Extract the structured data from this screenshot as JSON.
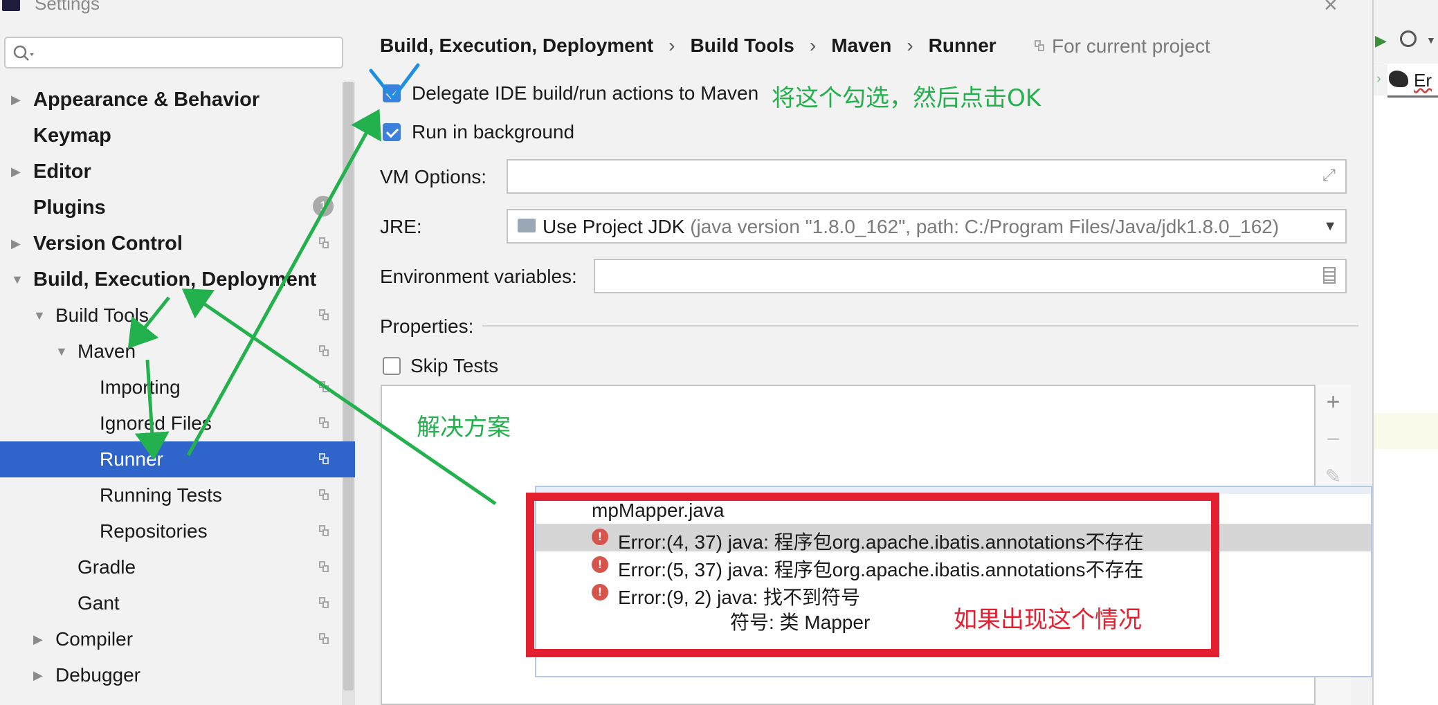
{
  "window": {
    "title": "Settings"
  },
  "sidebar": {
    "search_placeholder": "",
    "plugins_badge": "1",
    "items": [
      {
        "label": "Appearance & Behavior"
      },
      {
        "label": "Keymap"
      },
      {
        "label": "Editor"
      },
      {
        "label": "Plugins"
      },
      {
        "label": "Version Control"
      },
      {
        "label": "Build, Execution, Deployment"
      },
      {
        "label": "Build Tools"
      },
      {
        "label": "Maven"
      },
      {
        "label": "Importing"
      },
      {
        "label": "Ignored Files"
      },
      {
        "label": "Runner"
      },
      {
        "label": "Running Tests"
      },
      {
        "label": "Repositories"
      },
      {
        "label": "Gradle"
      },
      {
        "label": "Gant"
      },
      {
        "label": "Compiler"
      },
      {
        "label": "Debugger"
      }
    ]
  },
  "main": {
    "breadcrumb": [
      "Build, Execution, Deployment",
      "Build Tools",
      "Maven",
      "Runner"
    ],
    "breadcrumb_separator": "›",
    "for_current_project": "For current project",
    "delegate_label": "Delegate IDE build/run actions to Maven",
    "delegate_checked": true,
    "run_bg_label": "Run in background",
    "run_bg_checked": true,
    "vm_options_label": "VM Options:",
    "vm_options_value": "",
    "jre_label": "JRE:",
    "jre_value": "Use Project JDK",
    "jre_detail": "(java version \"1.8.0_162\", path: C:/Program Files/Java/jdk1.8.0_162)",
    "env_label": "Environment variables:",
    "env_value": "",
    "properties_label": "Properties:",
    "skip_tests_label": "Skip Tests",
    "skip_tests_checked": false,
    "toolbar": {
      "add": "+",
      "remove": "−"
    }
  },
  "right_strip": {
    "tab_label": "Er"
  },
  "error_popup": {
    "file_name": "mpMapper.java",
    "errors": [
      "Error:(4, 37)  java: 程序包org.apache.ibatis.annotations不存在",
      "Error:(5, 37)  java: 程序包org.apache.ibatis.annotations不存在",
      "Error:(9, 2)  java: 找不到符号"
    ],
    "symbol_line": "符号: 类 Mapper"
  },
  "annotations": {
    "check_this": "将这个勾选，然后点击OK",
    "solution": "解决方案",
    "if_this_happens": "如果出现这个情况",
    "arrow_color": "#22b14c",
    "box_color": "#e42030",
    "tick_color": "#1e8fe0"
  },
  "colors": {
    "selection": "#2f65ca",
    "checkbox_accent": "#3c7fdc",
    "error_icon": "#d6544c"
  }
}
